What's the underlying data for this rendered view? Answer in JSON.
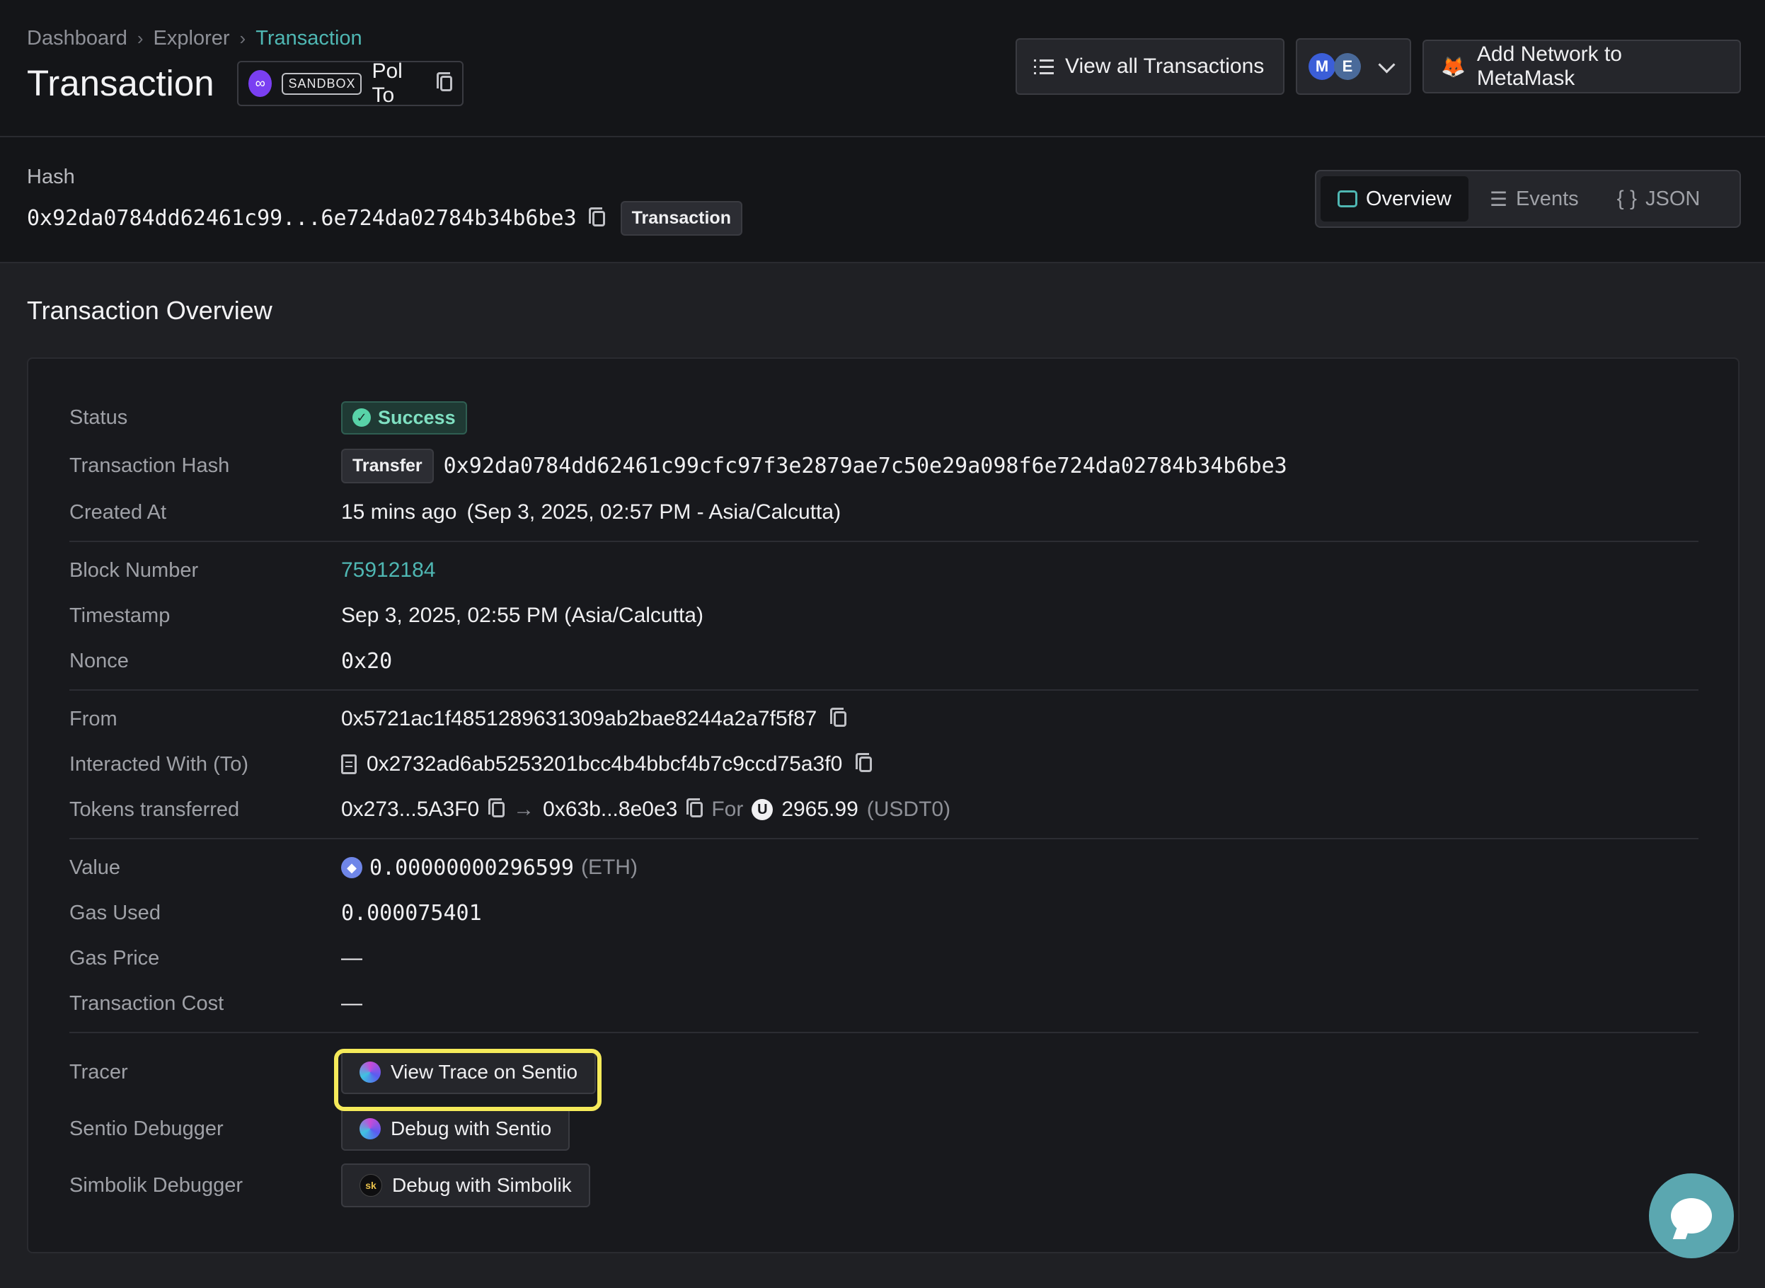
{
  "breadcrumb": [
    "Dashboard",
    "Explorer",
    "Transaction"
  ],
  "page_title": "Transaction",
  "network_chip": {
    "badge": "SANDBOX",
    "name": "Pol To"
  },
  "header_buttons": {
    "view_all": "View all Transactions",
    "avatar_a": "M",
    "avatar_b": "E",
    "add_network": "Add Network to MetaMask"
  },
  "hash_section": {
    "label": "Hash",
    "value": "0x92da0784dd62461c99...6e724da02784b34b6be3",
    "tag": "Transaction"
  },
  "tabs": [
    {
      "label": "Overview",
      "icon": "overview-icon"
    },
    {
      "label": "Events",
      "icon": "events-icon"
    },
    {
      "label": "JSON",
      "icon": "braces-icon"
    }
  ],
  "overview": {
    "title": "Transaction Overview",
    "status": {
      "label": "Status",
      "value": "Success"
    },
    "tx_hash": {
      "label": "Transaction Hash",
      "tag": "Transfer",
      "value": "0x92da0784dd62461c99cfc97f3e2879ae7c50e29a098f6e724da02784b34b6be3"
    },
    "created_at": {
      "label": "Created At",
      "relative": "15 mins ago",
      "absolute": "(Sep 3, 2025, 02:57 PM - Asia/Calcutta)"
    },
    "block_number": {
      "label": "Block Number",
      "value": "75912184"
    },
    "timestamp": {
      "label": "Timestamp",
      "value": "Sep 3, 2025, 02:55 PM (Asia/Calcutta)"
    },
    "nonce": {
      "label": "Nonce",
      "value": "0x20"
    },
    "from": {
      "label": "From",
      "value": "0x5721ac1f4851289631309ab2bae8244a2a7f5f87"
    },
    "to": {
      "label": "Interacted With (To)",
      "value": "0x2732ad6ab5253201bcc4b4bbcf4b7c9ccd75a3f0"
    },
    "tokens": {
      "label": "Tokens transferred",
      "from": "0x273...5A3F0",
      "arrow": "→",
      "to": "0x63b...8e0e3",
      "for": "For",
      "token_icon": "U",
      "amount": "2965.99",
      "symbol": "(USDT0)"
    },
    "value": {
      "label": "Value",
      "amount": "0.00000000296599",
      "unit": "(ETH)"
    },
    "gas_used": {
      "label": "Gas Used",
      "value": "0.000075401"
    },
    "gas_price": {
      "label": "Gas Price",
      "value": "—"
    },
    "tx_cost": {
      "label": "Transaction Cost",
      "value": "—"
    },
    "tracer": {
      "label": "Tracer",
      "button": "View Trace on Sentio"
    },
    "sentio_debugger": {
      "label": "Sentio Debugger",
      "button": "Debug with Sentio"
    },
    "simbolik_debugger": {
      "label": "Simbolik Debugger",
      "button": "Debug with Simbolik",
      "icon_text": "sk"
    }
  },
  "colors": {
    "accent": "#4fb7b3",
    "success": "#58d3a8",
    "highlight": "#f5ea5a"
  }
}
